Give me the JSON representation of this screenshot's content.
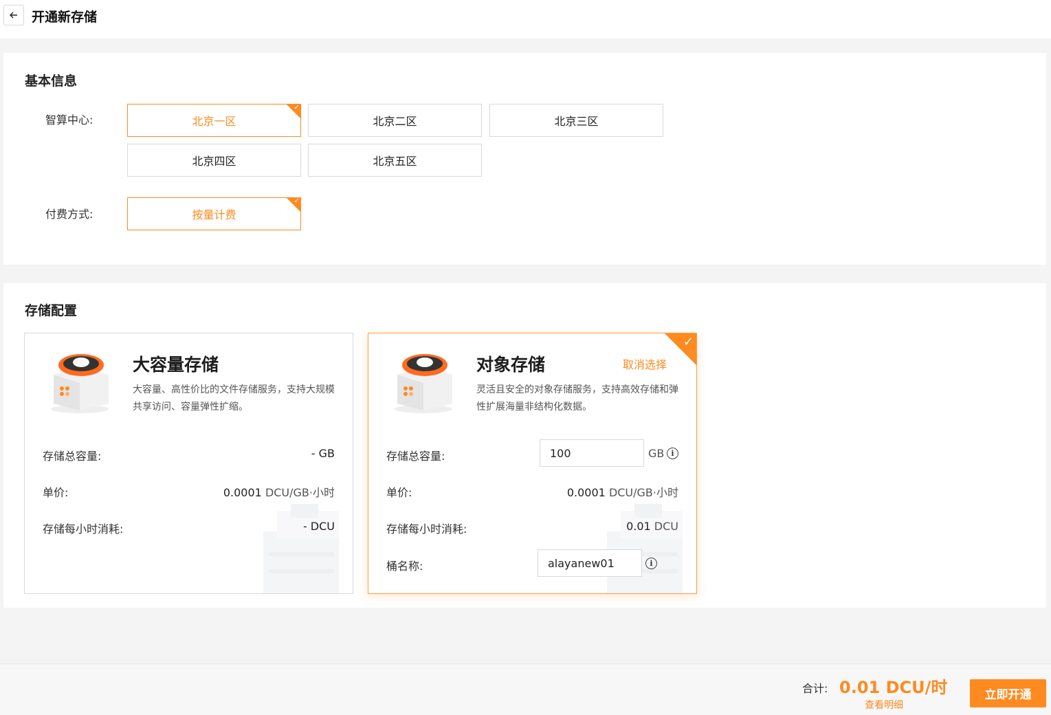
{
  "header": {
    "title": "开通新存储",
    "back_icon": "arrow-left-icon"
  },
  "basic": {
    "title": "基本信息",
    "datacenter_label": "智算中心:",
    "datacenters": [
      {
        "label": "北京一区",
        "selected": true
      },
      {
        "label": "北京二区",
        "selected": false
      },
      {
        "label": "北京三区",
        "selected": false
      },
      {
        "label": "北京四区",
        "selected": false
      },
      {
        "label": "北京五区",
        "selected": false
      }
    ],
    "billing_label": "付费方式:",
    "billing_options": [
      {
        "label": "按量计费",
        "selected": true
      }
    ]
  },
  "storage": {
    "title": "存储配置",
    "cards": [
      {
        "title": "大容量存储",
        "desc": "大容量、高性价比的文件存储服务，支持大规模共享访问、容量弹性扩缩。",
        "selected": false,
        "capacity_label": "存储总容量:",
        "capacity_value": "- GB",
        "price_label": "单价:",
        "price_num": "0.0001",
        "price_unit": "DCU/GB·小时",
        "hourly_label": "存储每小时消耗:",
        "hourly_value": "- DCU"
      },
      {
        "title": "对象存储",
        "desc": "灵活且安全的对象存储服务，支持高效存储和弹性扩展海量非结构化数据。",
        "selected": true,
        "cancel_label": "取消选择",
        "capacity_label": "存储总容量:",
        "capacity_input": "100",
        "capacity_unit": "GB",
        "price_label": "单价:",
        "price_num": "0.0001",
        "price_unit": "DCU/GB·小时",
        "hourly_label": "存储每小时消耗:",
        "hourly_num": "0.01",
        "hourly_unit": "DCU",
        "bucket_label": "桶名称:",
        "bucket_input": "alayanew01"
      }
    ]
  },
  "footer": {
    "total_label": "合计:",
    "total_value": "0.01 DCU/时",
    "detail_link": "查看明细",
    "submit_label": "立即开通"
  },
  "colors": {
    "accent": "#ff8a1f",
    "background": "#f4f4f5"
  }
}
